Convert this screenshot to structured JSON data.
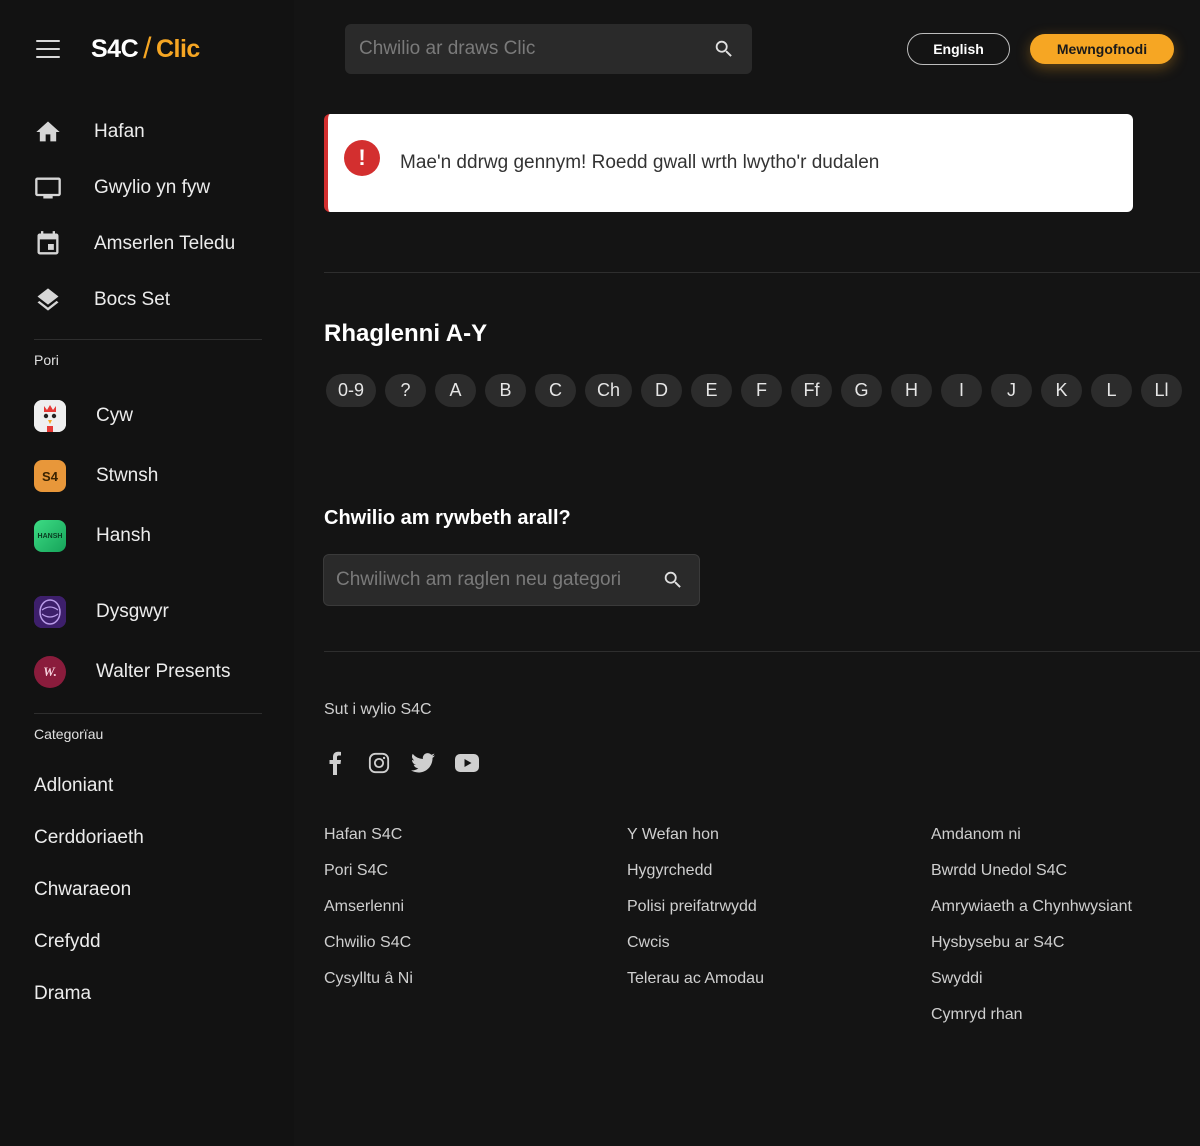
{
  "header": {
    "logo_s4c": "S4C",
    "logo_slash": "/",
    "logo_clic": "Clic",
    "search_placeholder": "Chwilio ar draws Clic",
    "english_label": "English",
    "login_label": "Mewngofnodi",
    "accent_color": "#f6a623"
  },
  "sidebar": {
    "main_items": [
      {
        "label": "Hafan",
        "icon": "home-icon"
      },
      {
        "label": "Gwylio yn fyw",
        "icon": "tv-icon"
      },
      {
        "label": "Amserlen Teledu",
        "icon": "calendar-icon"
      },
      {
        "label": "Bocs Set",
        "icon": "layers-icon"
      }
    ],
    "pori_title": "Pori",
    "pori_items": [
      {
        "label": "Cyw",
        "icon": "cyw-logo-icon"
      },
      {
        "label": "Stwnsh",
        "icon": "stwnsh-logo-icon",
        "badge_text": "S4"
      },
      {
        "label": "Hansh",
        "icon": "hansh-logo-icon",
        "badge_text": "HANSH"
      },
      {
        "label": "Dysgwyr",
        "icon": "dysgwyr-logo-icon"
      },
      {
        "label": "Walter Presents",
        "icon": "walter-presents-logo-icon",
        "badge_text": "W."
      }
    ],
    "categories_title": "Categorïau",
    "categories": [
      "Adloniant",
      "Cerddoriaeth",
      "Chwaraeon",
      "Crefydd",
      "Drama"
    ]
  },
  "error": {
    "message": "Mae'n ddrwg gennym! Roedd gwall wrth lwytho'r dudalen",
    "icon_glyph": "!",
    "color": "#d32f2f"
  },
  "programmes": {
    "title": "Rhaglenni A-Y",
    "letters": [
      "0-9",
      "?",
      "A",
      "B",
      "C",
      "Ch",
      "D",
      "E",
      "F",
      "Ff",
      "G",
      "H",
      "I",
      "J",
      "K",
      "L",
      "Ll"
    ]
  },
  "search_section": {
    "title": "Chwilio am rywbeth arall?",
    "placeholder": "Chwiliwch am raglen neu gategori"
  },
  "footer": {
    "watch_label": "Sut i wylio S4C",
    "socials": [
      "facebook-icon",
      "instagram-icon",
      "twitter-icon",
      "youtube-icon"
    ],
    "col1": [
      "Hafan S4C",
      "Pori S4C",
      "Amserlenni",
      "Chwilio S4C",
      "Cysylltu â Ni"
    ],
    "col2": [
      "Y Wefan hon",
      "Hygyrchedd",
      "Polisi preifatrwydd",
      "Cwcis",
      "Telerau ac Amodau"
    ],
    "col3": [
      "Amdanom ni",
      "Bwrdd Unedol S4C",
      "Amrywiaeth a Chynhwysiant",
      "Hysbysebu ar S4C",
      "Swyddi",
      "Cymryd rhan"
    ]
  }
}
